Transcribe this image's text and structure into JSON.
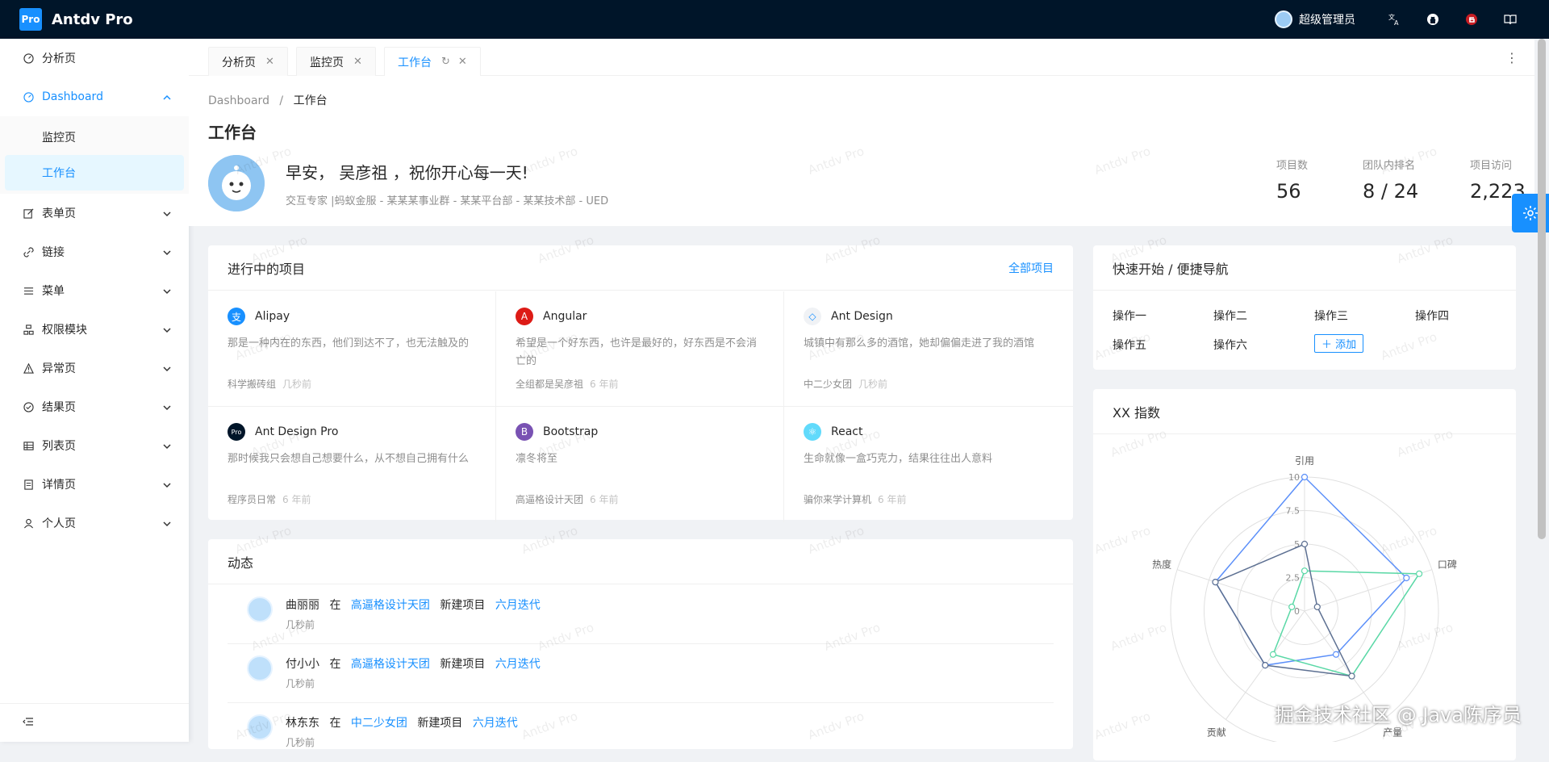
{
  "header": {
    "logo_badge": "Pro",
    "app_title": "Antdv Pro",
    "user_name": "超级管理员",
    "icons": [
      "translate-icon",
      "github-icon",
      "gitee-icon",
      "doc-icon"
    ]
  },
  "sidebar": {
    "items": [
      {
        "label": "分析页",
        "icon": "dashboard-icon"
      },
      {
        "label": "Dashboard",
        "icon": "dashboard-icon"
      },
      {
        "label": "表单页",
        "icon": "form-icon"
      },
      {
        "label": "链接",
        "icon": "link-icon"
      },
      {
        "label": "菜单",
        "icon": "menu-icon"
      },
      {
        "label": "权限模块",
        "icon": "cluster-icon"
      },
      {
        "label": "异常页",
        "icon": "warning-icon"
      },
      {
        "label": "结果页",
        "icon": "check-circle-icon"
      },
      {
        "label": "列表页",
        "icon": "table-icon"
      },
      {
        "label": "详情页",
        "icon": "profile-icon"
      },
      {
        "label": "个人页",
        "icon": "user-icon"
      }
    ],
    "sub_items": [
      "监控页",
      "工作台"
    ]
  },
  "tabs": [
    {
      "label": "分析页"
    },
    {
      "label": "监控页"
    },
    {
      "label": "工作台"
    }
  ],
  "breadcrumb": {
    "root": "Dashboard",
    "separator": "/",
    "current": "工作台"
  },
  "page": {
    "title": "工作台",
    "greeting": "早安， 吴彦祖 ，祝你开心每一天!",
    "description": "交互专家 |蚂蚁金服 - 某某某事业群 - 某某平台部 - 某某技术部 - UED",
    "stats": [
      {
        "label": "项目数",
        "value": "56"
      },
      {
        "label": "团队内排名",
        "value": "8 / 24"
      },
      {
        "label": "项目访问",
        "value": "2,223"
      }
    ]
  },
  "projects_card": {
    "title": "进行中的项目",
    "extra": "全部项目",
    "items": [
      {
        "name": "Alipay",
        "desc": "那是一种内在的东西，他们到达不了，也无法触及的",
        "team": "科学搬砖组",
        "time": "几秒前",
        "color": "#1890ff",
        "glyph": "支"
      },
      {
        "name": "Angular",
        "desc": "希望是一个好东西，也许是最好的，好东西是不会消亡的",
        "team": "全组都是吴彦祖",
        "time": "6 年前",
        "color": "#dd1b16",
        "glyph": "A"
      },
      {
        "name": "Ant Design",
        "desc": "城镇中有那么多的酒馆，她却偏偏走进了我的酒馆",
        "team": "中二少女团",
        "time": "几秒前",
        "color": "#f0f2f5",
        "glyph": "◇"
      },
      {
        "name": "Ant Design Pro",
        "desc": "那时候我只会想自己想要什么，从不想自己拥有什么",
        "team": "程序员日常",
        "time": "6 年前",
        "color": "#001529",
        "glyph": "Pro"
      },
      {
        "name": "Bootstrap",
        "desc": "凛冬将至",
        "team": "高逼格设计天团",
        "time": "6 年前",
        "color": "#7952b3",
        "glyph": "B"
      },
      {
        "name": "React",
        "desc": "生命就像一盒巧克力，结果往往出人意料",
        "team": "骗你来学计算机",
        "time": "6 年前",
        "color": "#61dafb",
        "glyph": "⚛"
      }
    ]
  },
  "activity_card": {
    "title": "动态",
    "items": [
      {
        "user": "曲丽丽",
        "in": "在",
        "group": "高逼格设计天团",
        "action": "新建项目",
        "project": "六月迭代",
        "time": "几秒前"
      },
      {
        "user": "付小小",
        "in": "在",
        "group": "高逼格设计天团",
        "action": "新建项目",
        "project": "六月迭代",
        "time": "几秒前"
      },
      {
        "user": "林东东",
        "in": "在",
        "group": "中二少女团",
        "action": "新建项目",
        "project": "六月迭代",
        "time": "几秒前"
      }
    ]
  },
  "quick_card": {
    "title": "快速开始 / 便捷导航",
    "items": [
      "操作一",
      "操作二",
      "操作三",
      "操作四",
      "操作五",
      "操作六"
    ],
    "add_label": "添加"
  },
  "radar_card": {
    "title": "XX 指数"
  },
  "chart_data": {
    "type": "radar",
    "axes": [
      "引用",
      "口碑",
      "产量",
      "贡献",
      "热度"
    ],
    "ticks": [
      "10",
      "7.5",
      "5",
      "2.5",
      "0"
    ],
    "range": [
      0,
      10
    ],
    "series": [
      {
        "values": [
          10,
          8,
          4,
          5,
          7
        ],
        "color": "#5b8ff9"
      },
      {
        "values": [
          3,
          9,
          6,
          4,
          1
        ],
        "color": "#5ad8a6"
      },
      {
        "values": [
          5,
          1,
          6,
          5,
          7
        ],
        "color": "#5d7092"
      }
    ]
  },
  "watermark": "Antdv Pro",
  "footer_watermark": "掘金技术社区 @ Java陈序员"
}
